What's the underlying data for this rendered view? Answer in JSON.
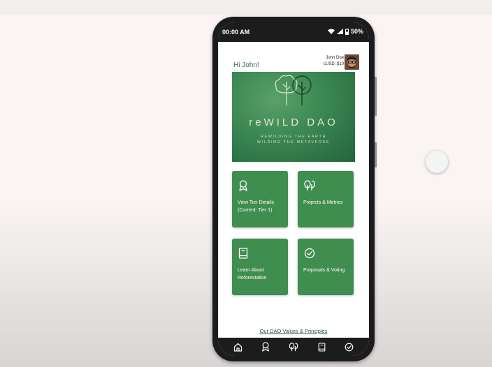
{
  "status_bar": {
    "time": "00:00 AM",
    "battery": "50%"
  },
  "header": {
    "greeting": "Hi John!",
    "user_name": "John Doe",
    "balance": "cUSD: $10"
  },
  "hero": {
    "title": "reWILD DAO",
    "subtitle_line1": "REWILDING THE EARTH",
    "subtitle_line2": "WILDING THE METAVERSE"
  },
  "tiles": [
    {
      "line1": "View Tier Details",
      "line2": "(Current: Tier 1)",
      "icon": "award-icon"
    },
    {
      "line1": "Projects & Metrics",
      "line2": "",
      "icon": "trees-icon"
    },
    {
      "line1": "Learn About",
      "line2": "Reforestation",
      "icon": "book-icon"
    },
    {
      "line1": "Proposals & Voting",
      "line2": "",
      "icon": "check-circle-icon"
    }
  ],
  "footer_link": "Our DAO Values & Principles",
  "bottom_nav": [
    "home-icon",
    "award-icon",
    "trees-icon",
    "book-icon",
    "check-circle-icon"
  ],
  "colors": {
    "accent_green": "#3f8d4f",
    "text_green": "#2f6b43",
    "frame": "#1c1c1e"
  }
}
